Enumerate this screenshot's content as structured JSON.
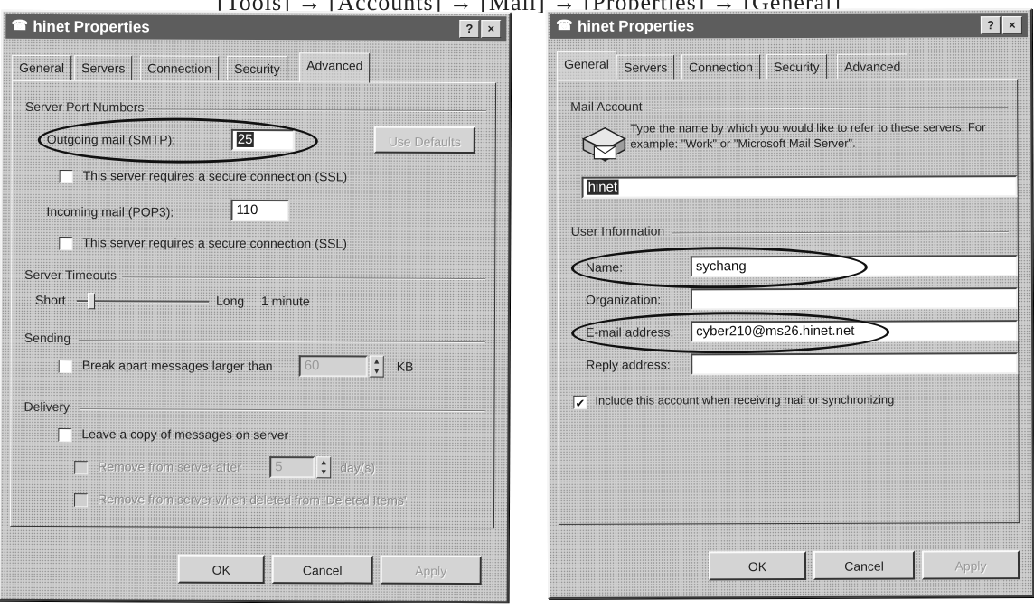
{
  "caption": "[Tools] → [Accounts] → [Mail] → [Properties] → [General]",
  "left_dialog": {
    "title": "hinet Properties",
    "title_buttons": [
      "?",
      "×"
    ],
    "tabs": [
      "General",
      "Servers",
      "Connection",
      "Security",
      "Advanced"
    ],
    "active_tab": "Advanced",
    "server_ports": {
      "group": "Server Port Numbers",
      "outgoing_label": "Outgoing mail (SMTP):",
      "outgoing_value": "25",
      "use_defaults": "Use Defaults",
      "ssl1": "This server requires a secure connection (SSL)",
      "incoming_label": "Incoming mail (POP3):",
      "incoming_value": "110",
      "ssl2": "This server requires a secure connection (SSL)"
    },
    "timeouts": {
      "group": "Server Timeouts",
      "short": "Short",
      "long": "Long",
      "value": "1 minute"
    },
    "sending": {
      "group": "Sending",
      "break_apart": "Break apart messages larger than",
      "size_value": "60",
      "unit": "KB"
    },
    "delivery": {
      "group": "Delivery",
      "leave_copy": "Leave a copy of messages on server",
      "remove_after": "Remove from server after",
      "days_value": "5",
      "days": "day(s)",
      "remove_deleted": "Remove from server when deleted from 'Deleted Items'"
    },
    "buttons": {
      "ok": "OK",
      "cancel": "Cancel",
      "apply": "Apply"
    }
  },
  "right_dialog": {
    "title": "hinet Properties",
    "title_buttons": [
      "?",
      "×"
    ],
    "tabs": [
      "General",
      "Servers",
      "Connection",
      "Security",
      "Advanced"
    ],
    "active_tab": "General",
    "mail_account": {
      "group": "Mail Account",
      "desc": "Type the name by which you would like to refer to these servers.  For example: \"Work\" or \"Microsoft Mail Server\".",
      "account_name": "hinet"
    },
    "user_info": {
      "group": "User Information",
      "name_label": "Name:",
      "name_value": "sychang",
      "org_label": "Organization:",
      "org_value": "",
      "email_label": "E-mail address:",
      "email_value": "cyber210@ms26.hinet.net",
      "reply_label": "Reply address:",
      "reply_value": ""
    },
    "include_label": "Include this account when receiving mail or synchronizing",
    "include_checked": "✔",
    "buttons": {
      "ok": "OK",
      "cancel": "Cancel",
      "apply": "Apply"
    }
  }
}
